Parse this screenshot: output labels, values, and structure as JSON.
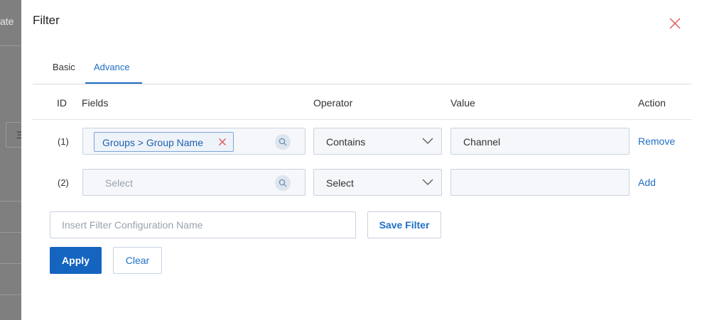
{
  "backdrop": {
    "partial_text": "ate",
    "button_glyph": "Ξ"
  },
  "dialog": {
    "title": "Filter",
    "close_icon": "close-x-icon",
    "tabs": [
      {
        "label": "Basic",
        "active": false
      },
      {
        "label": "Advance",
        "active": true
      }
    ]
  },
  "table": {
    "headers": {
      "id": "ID",
      "fields": "Fields",
      "operator": "Operator",
      "value": "Value",
      "action": "Action"
    },
    "rows": [
      {
        "id": "(1)",
        "field_chip": "Groups > Group Name",
        "operator": "Contains",
        "value": "Channel",
        "action": "Remove"
      },
      {
        "id": "(2)",
        "field_placeholder": "Select",
        "operator": "Select",
        "value": "",
        "action": "Add"
      }
    ]
  },
  "config": {
    "placeholder": "Insert Filter Configuration Name",
    "save_label": "Save Filter"
  },
  "buttons": {
    "apply": "Apply",
    "clear": "Clear"
  },
  "colors": {
    "accent": "#1f6fc5",
    "primary_button": "#1565c0",
    "close_icon": "#e05555"
  }
}
